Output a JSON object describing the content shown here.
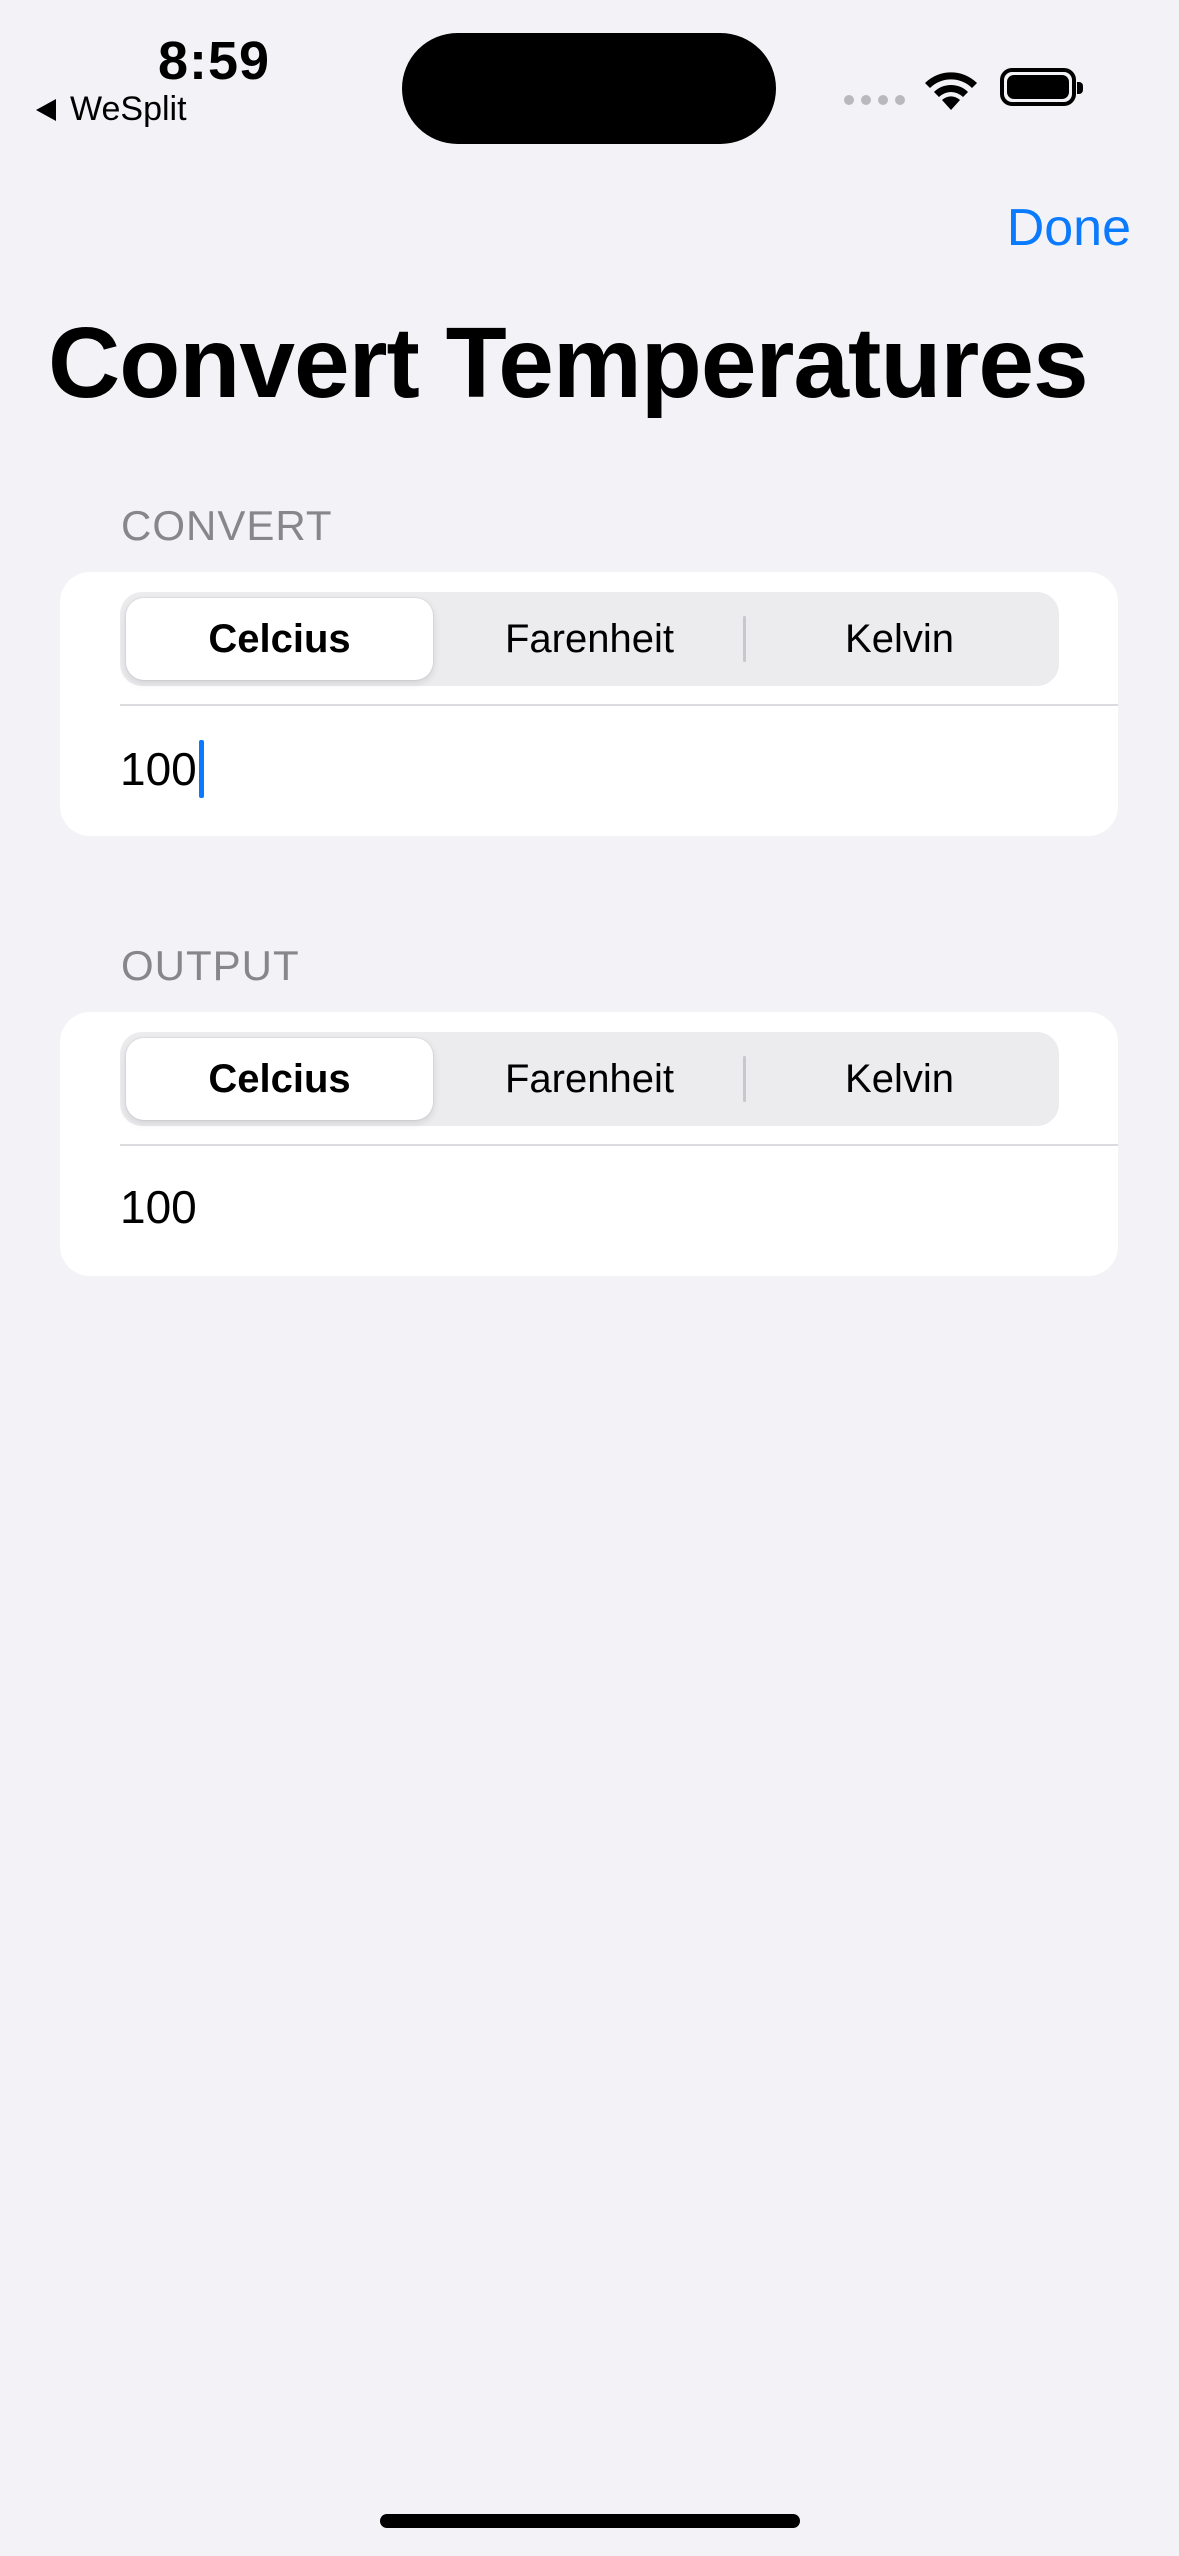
{
  "status_bar": {
    "time": "8:59",
    "back_app": "WeSplit"
  },
  "nav": {
    "done_label": "Done",
    "title": "Convert Temperatures"
  },
  "convert_section": {
    "header": "CONVERT",
    "units": [
      "Celcius",
      "Farenheit",
      "Kelvin"
    ],
    "selected_unit": "Celcius",
    "input_value": "100"
  },
  "output_section": {
    "header": "OUTPUT",
    "units": [
      "Celcius",
      "Farenheit",
      "Kelvin"
    ],
    "selected_unit": "Celcius",
    "output_value": "100"
  },
  "colors": {
    "accent": "#0a7aff",
    "background": "#f2f2f7",
    "secondary_text": "#86868b"
  }
}
